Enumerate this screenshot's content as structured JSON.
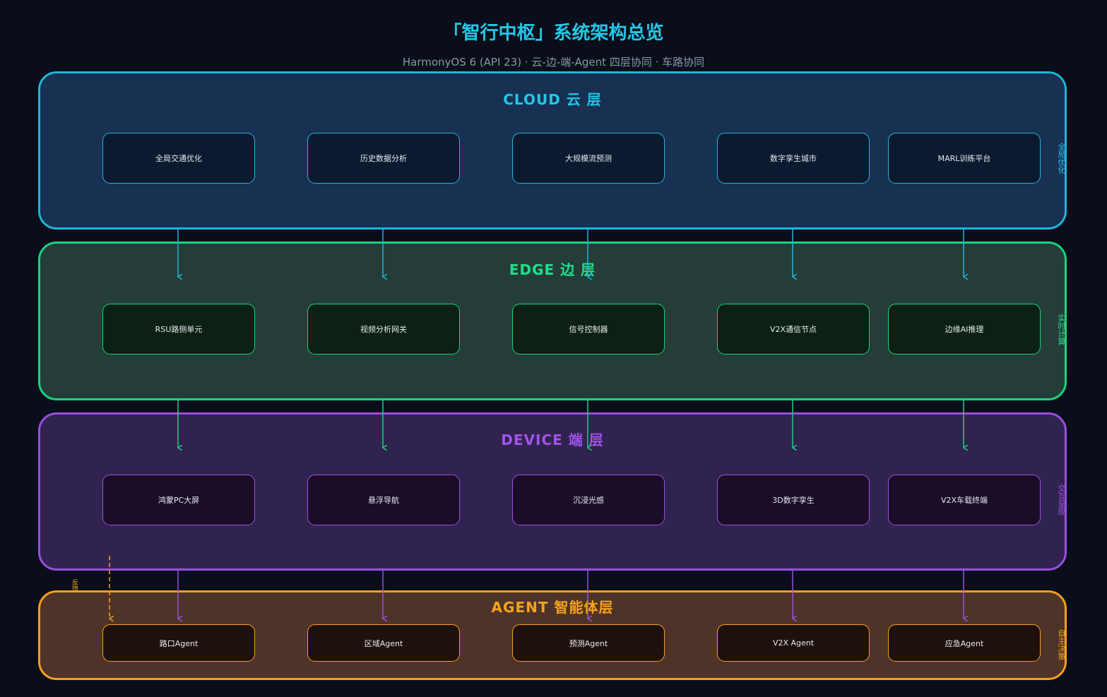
{
  "title": "「智行中枢」系统架构总览",
  "subtitle": "HarmonyOS 6 (API 23) · 云-边-端-Agent 四层协同 · 车路协同",
  "colors": {
    "cloud": "#1eb6d8",
    "edge": "#19d37e",
    "device": "#9a4fe0",
    "agent": "#f5a01c"
  },
  "layers": [
    {
      "id": "cloud",
      "title": "CLOUD 云 层",
      "side_label": "全局优化",
      "nodes": [
        "全局交通优化",
        "历史数据分析",
        "大规模流预测",
        "数字孪生城市",
        "MARL训练平台"
      ]
    },
    {
      "id": "edge",
      "title": "EDGE 边 层",
      "side_label": "实时计算",
      "nodes": [
        "RSU路侧单元",
        "视频分析网关",
        "信号控制器",
        "V2X通信节点",
        "边缘AI推理"
      ]
    },
    {
      "id": "device",
      "title": "DEVICE 端 层",
      "side_label": "交互呈现",
      "nodes": [
        "鸿蒙PC大屏",
        "悬浮导航",
        "沉浸光感",
        "3D数字孪生",
        "V2X车载终端"
      ]
    },
    {
      "id": "agent",
      "title": "AGENT 智能体层",
      "side_label": "自主决策",
      "nodes": [
        "路口Agent",
        "区域Agent",
        "预测Agent",
        "V2X Agent",
        "应急Agent"
      ]
    }
  ],
  "feedback_label": "反馈"
}
